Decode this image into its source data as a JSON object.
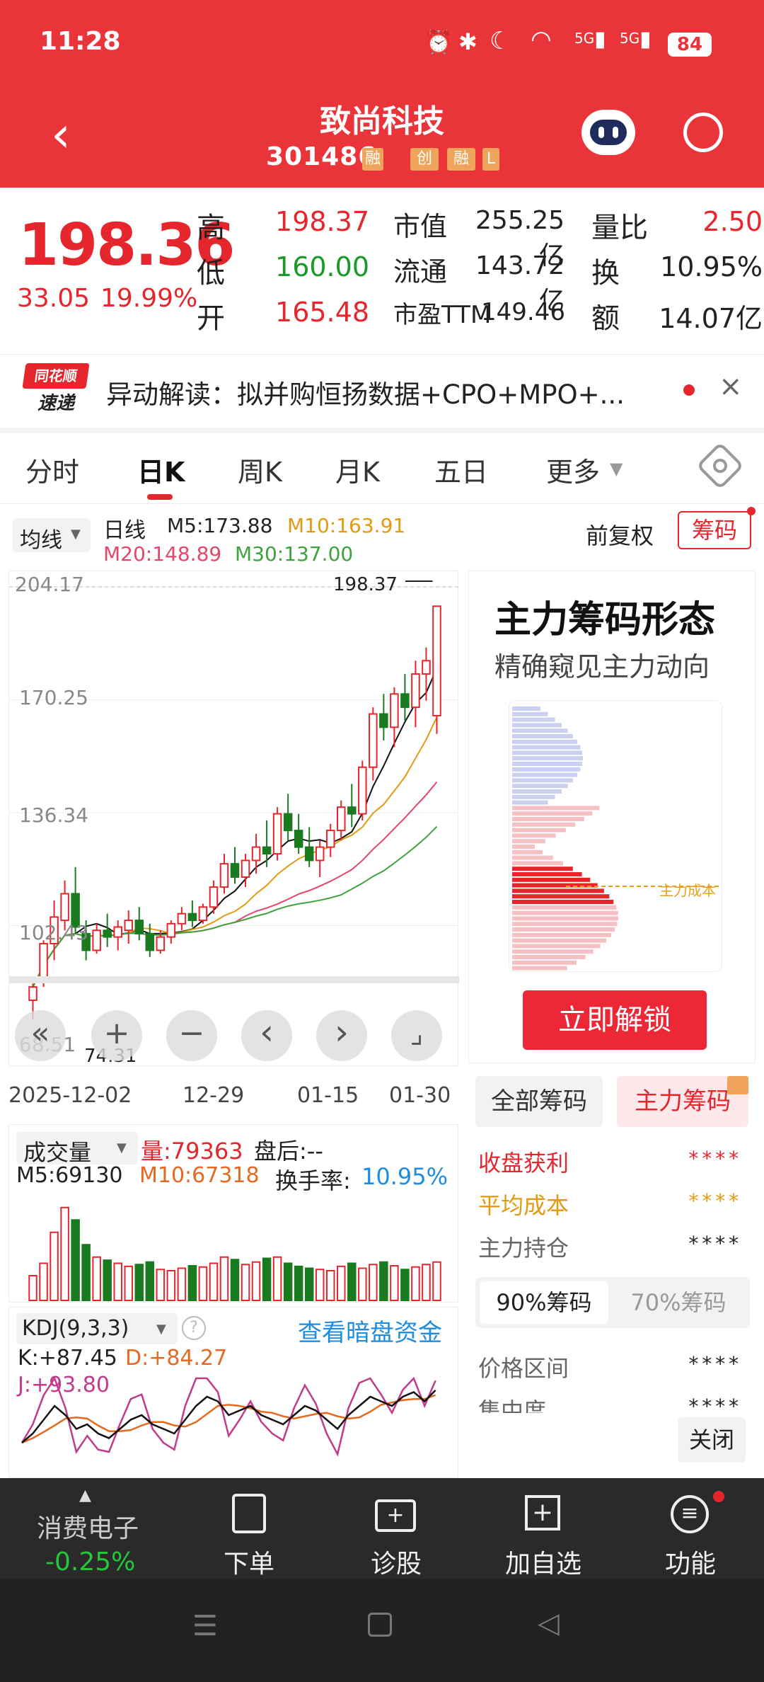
{
  "status_bar": {
    "time": "11:28",
    "net1": "5G",
    "net2": "5G",
    "battery": "84"
  },
  "header": {
    "title": "致尚科技",
    "code": "301486",
    "tags": [
      "融",
      "创",
      "融",
      "L"
    ]
  },
  "quote": {
    "price": "198.36",
    "change": "33.05",
    "change_pct": "19.99%",
    "rows": [
      {
        "l1": "高",
        "v1": "198.37",
        "l2": "市值",
        "v2": "255.25亿",
        "l3": "量比",
        "v3": "2.50"
      },
      {
        "l1": "低",
        "v1": "160.00",
        "l2": "流通",
        "v2": "143.72亿",
        "l3": "换",
        "v3": "10.95%"
      },
      {
        "l1": "开",
        "v1": "165.48",
        "l2": "市盈TTM",
        "v2": "149.46",
        "l3": "额",
        "v3": "14.07亿"
      }
    ]
  },
  "news": {
    "brand_top": "同花顺",
    "brand_bottom": "速递",
    "text": "异动解读：拟并购恒扬数据+CPO+MPO+..."
  },
  "tabs": [
    "分时",
    "日K",
    "周K",
    "月K",
    "五日",
    "更多"
  ],
  "active_tab": "日K",
  "kline": {
    "indicator_select": "均线",
    "label": "日线",
    "ma": {
      "m5": "M5:173.88",
      "m10": "M10:163.91",
      "m20": "M20:148.89",
      "m30": "M30:137.00"
    },
    "adjust": "前复权",
    "chip_btn": "筹码",
    "y_ticks": [
      "204.17",
      "170.25",
      "136.34",
      "102.43"
    ],
    "bottom_tick": "68.51",
    "high_label": "198.37",
    "low_label": "74.31",
    "x_ticks": [
      "2025-12-02",
      "12-29",
      "01-15",
      "01-30"
    ],
    "controls": [
      "«",
      "+",
      "−",
      "‹",
      "›",
      "⌟"
    ]
  },
  "volume": {
    "select": "成交量",
    "vol": "量:79363",
    "after": "盘后:--",
    "m5": "M5:69130",
    "m10": "M10:67318",
    "turnover_label": "换手率:",
    "turnover": "10.95%"
  },
  "kdj": {
    "select": "KDJ(9,3,3)",
    "link": "查看暗盘资金",
    "k": "K:+87.45",
    "d": "D:+84.27",
    "j": "J:+93.80"
  },
  "chips_panel": {
    "title": "主力筹码形态",
    "subtitle": "精确窥见主力动向",
    "cost_label": "主力成本",
    "unlock": "立即解锁",
    "tab_all": "全部筹码",
    "tab_main": "主力筹码",
    "rows": [
      {
        "label": "收盘获利",
        "value": "****"
      },
      {
        "label": "平均成本",
        "value": "****"
      },
      {
        "label": "主力持仓",
        "value": "****"
      }
    ],
    "pct90": "90%筹码",
    "pct70": "70%筹码",
    "price_range": "价格区间",
    "concentration": "集中度",
    "range_val": "****",
    "conc_val": "****",
    "close": "关闭"
  },
  "bottom_nav": {
    "sector": "消费电子",
    "sector_chg": "-0.25%",
    "items": [
      "下单",
      "诊股",
      "加自选",
      "功能"
    ]
  },
  "chart_data": {
    "type": "candlestick",
    "categories": [
      "2025-12-02",
      "",
      "",
      "",
      "",
      "",
      "",
      "",
      "",
      "",
      "",
      "",
      "",
      "",
      "",
      "12-29",
      "",
      "",
      "",
      "",
      "",
      "",
      "",
      "",
      "",
      "",
      "01-15",
      "",
      "",
      "",
      "",
      "",
      "",
      "",
      "",
      "",
      "",
      "",
      "01-30"
    ],
    "series": [
      {
        "name": "日K",
        "ohlc": [
          [
            80,
            85,
            74.31,
            84
          ],
          [
            86,
            98,
            84,
            97
          ],
          [
            97,
            110,
            92,
            105
          ],
          [
            104,
            116,
            101,
            112
          ],
          [
            112,
            120,
            100,
            102
          ],
          [
            100,
            104,
            92,
            95
          ],
          [
            95,
            103,
            94,
            101
          ],
          [
            101,
            106,
            96,
            99
          ],
          [
            99,
            104,
            95,
            102
          ],
          [
            101,
            107,
            97,
            104
          ],
          [
            104,
            108,
            98,
            100
          ],
          [
            100,
            103,
            93,
            95
          ],
          [
            95,
            101,
            94,
            99
          ],
          [
            99,
            104,
            97,
            103
          ],
          [
            103,
            108,
            101,
            106
          ],
          [
            106,
            110,
            102,
            104
          ],
          [
            104,
            109,
            103,
            108
          ],
          [
            108,
            116,
            106,
            114
          ],
          [
            114,
            124,
            112,
            121
          ],
          [
            121,
            126,
            115,
            117
          ],
          [
            117,
            124,
            114,
            122
          ],
          [
            122,
            130,
            118,
            126
          ],
          [
            126,
            134,
            120,
            124
          ],
          [
            124,
            138,
            122,
            136
          ],
          [
            136,
            142,
            128,
            131
          ],
          [
            131,
            136,
            124,
            126
          ],
          [
            126,
            132,
            120,
            122
          ],
          [
            122,
            128,
            117,
            126
          ],
          [
            126,
            133,
            123,
            131
          ],
          [
            131,
            140,
            128,
            138
          ],
          [
            138,
            145,
            132,
            136
          ],
          [
            136,
            152,
            134,
            150
          ],
          [
            150,
            168,
            146,
            166
          ],
          [
            166,
            172,
            158,
            162
          ],
          [
            162,
            174,
            156,
            172
          ],
          [
            172,
            178,
            164,
            168
          ],
          [
            168,
            182,
            162,
            178
          ],
          [
            178,
            186,
            170,
            182
          ],
          [
            165.48,
            198.37,
            160,
            198.36
          ]
        ]
      }
    ],
    "ylim": [
      68.51,
      204.17
    ]
  }
}
